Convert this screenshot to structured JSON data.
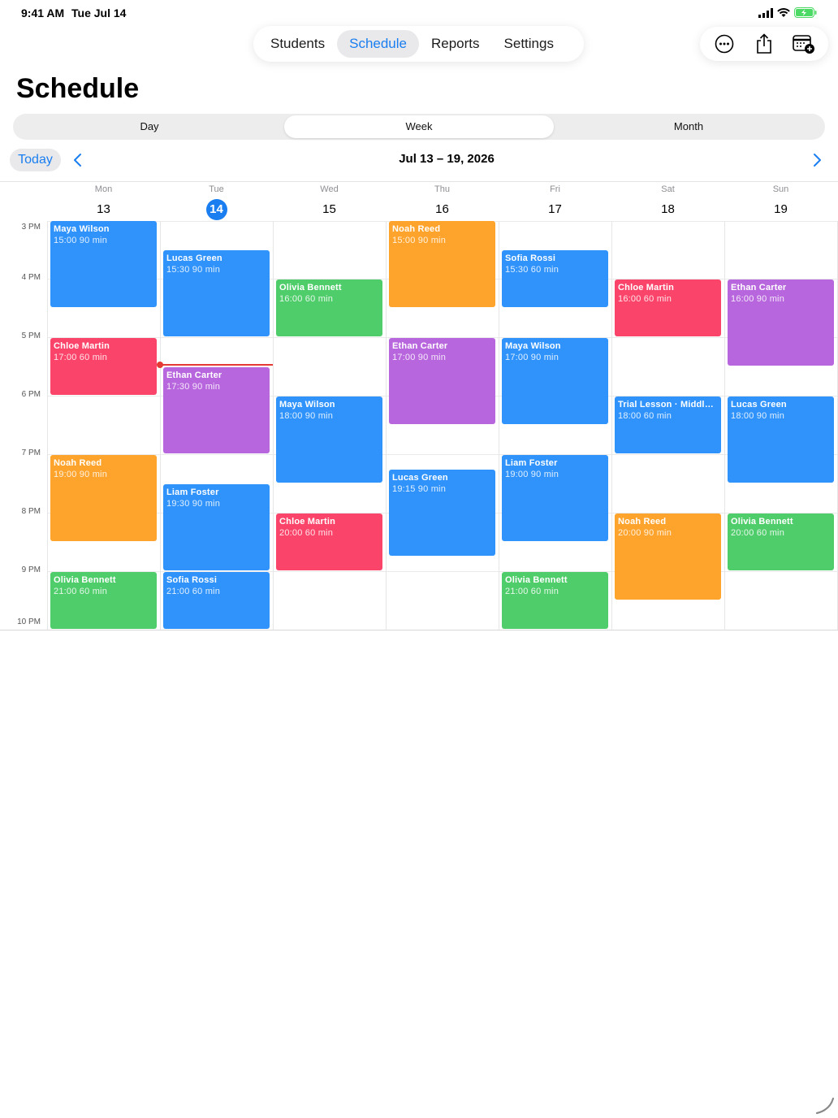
{
  "status": {
    "time": "9:41 AM",
    "date": "Tue Jul 14"
  },
  "tabs": [
    {
      "label": "Students",
      "active": false
    },
    {
      "label": "Schedule",
      "active": true
    },
    {
      "label": "Reports",
      "active": false
    },
    {
      "label": "Settings",
      "active": false
    }
  ],
  "actions": [
    "more-icon",
    "share-icon",
    "calendar-add-icon"
  ],
  "page_title": "Schedule",
  "view_modes": [
    {
      "label": "Day",
      "active": false
    },
    {
      "label": "Week",
      "active": true
    },
    {
      "label": "Month",
      "active": false
    }
  ],
  "week_nav": {
    "today_label": "Today",
    "range": "Jul 13 – 19, 2026"
  },
  "days": [
    {
      "name": "Mon",
      "num": "13",
      "today": false
    },
    {
      "name": "Tue",
      "num": "14",
      "today": true
    },
    {
      "name": "Wed",
      "num": "15",
      "today": false
    },
    {
      "name": "Thu",
      "num": "16",
      "today": false
    },
    {
      "name": "Fri",
      "num": "17",
      "today": false
    },
    {
      "name": "Sat",
      "num": "18",
      "today": false
    },
    {
      "name": "Sun",
      "num": "19",
      "today": false
    }
  ],
  "hours": [
    "3 PM",
    "4 PM",
    "5 PM",
    "6 PM",
    "7 PM",
    "8 PM",
    "9 PM",
    "10 PM"
  ],
  "colors": {
    "blue": "#2f93fb",
    "orange": "#fea32b",
    "green": "#50cd6b",
    "red": "#fb446a",
    "purple": "#b866dd",
    "accent": "#1a7ef0",
    "now": "#e53935"
  },
  "now_time": "17:30",
  "events": [
    {
      "day": 0,
      "name": "Maya Wilson",
      "start": "15:00",
      "duration": "90 min",
      "color": "blue"
    },
    {
      "day": 0,
      "name": "Chloe Martin",
      "start": "17:00",
      "duration": "60 min",
      "color": "red"
    },
    {
      "day": 0,
      "name": "Noah Reed",
      "start": "19:00",
      "duration": "90 min",
      "color": "orange"
    },
    {
      "day": 0,
      "name": "Olivia Bennett",
      "start": "21:00",
      "duration": "60 min",
      "color": "green"
    },
    {
      "day": 1,
      "name": "Lucas Green",
      "start": "15:30",
      "duration": "90 min",
      "color": "blue"
    },
    {
      "day": 1,
      "name": "Ethan Carter",
      "start": "17:30",
      "duration": "90 min",
      "color": "purple"
    },
    {
      "day": 1,
      "name": "Liam Foster",
      "start": "19:30",
      "duration": "90 min",
      "color": "blue"
    },
    {
      "day": 1,
      "name": "Sofia Rossi",
      "start": "21:00",
      "duration": "60 min",
      "color": "blue"
    },
    {
      "day": 2,
      "name": "Olivia Bennett",
      "start": "16:00",
      "duration": "60 min",
      "color": "green"
    },
    {
      "day": 2,
      "name": "Maya Wilson",
      "start": "18:00",
      "duration": "90 min",
      "color": "blue"
    },
    {
      "day": 2,
      "name": "Chloe Martin",
      "start": "20:00",
      "duration": "60 min",
      "color": "red"
    },
    {
      "day": 3,
      "name": "Noah Reed",
      "start": "15:00",
      "duration": "90 min",
      "color": "orange"
    },
    {
      "day": 3,
      "name": "Ethan Carter",
      "start": "17:00",
      "duration": "90 min",
      "color": "purple"
    },
    {
      "day": 3,
      "name": "Lucas Green",
      "start": "19:15",
      "duration": "90 min",
      "color": "blue"
    },
    {
      "day": 4,
      "name": "Sofia Rossi",
      "start": "15:30",
      "duration": "60 min",
      "color": "blue"
    },
    {
      "day": 4,
      "name": "Maya Wilson",
      "start": "17:00",
      "duration": "90 min",
      "color": "blue"
    },
    {
      "day": 4,
      "name": "Liam Foster",
      "start": "19:00",
      "duration": "90 min",
      "color": "blue"
    },
    {
      "day": 4,
      "name": "Olivia Bennett",
      "start": "21:00",
      "duration": "60 min",
      "color": "green"
    },
    {
      "day": 5,
      "name": "Chloe Martin",
      "start": "16:00",
      "duration": "60 min",
      "color": "red"
    },
    {
      "day": 5,
      "name": "Trial Lesson · Middle School",
      "start": "18:00",
      "duration": "60 min",
      "color": "blue"
    },
    {
      "day": 5,
      "name": "Noah Reed",
      "start": "20:00",
      "duration": "90 min",
      "color": "orange"
    },
    {
      "day": 6,
      "name": "Ethan Carter",
      "start": "16:00",
      "duration": "90 min",
      "color": "purple"
    },
    {
      "day": 6,
      "name": "Lucas Green",
      "start": "18:00",
      "duration": "90 min",
      "color": "blue"
    },
    {
      "day": 6,
      "name": "Olivia Bennett",
      "start": "20:00",
      "duration": "60 min",
      "color": "green"
    }
  ]
}
